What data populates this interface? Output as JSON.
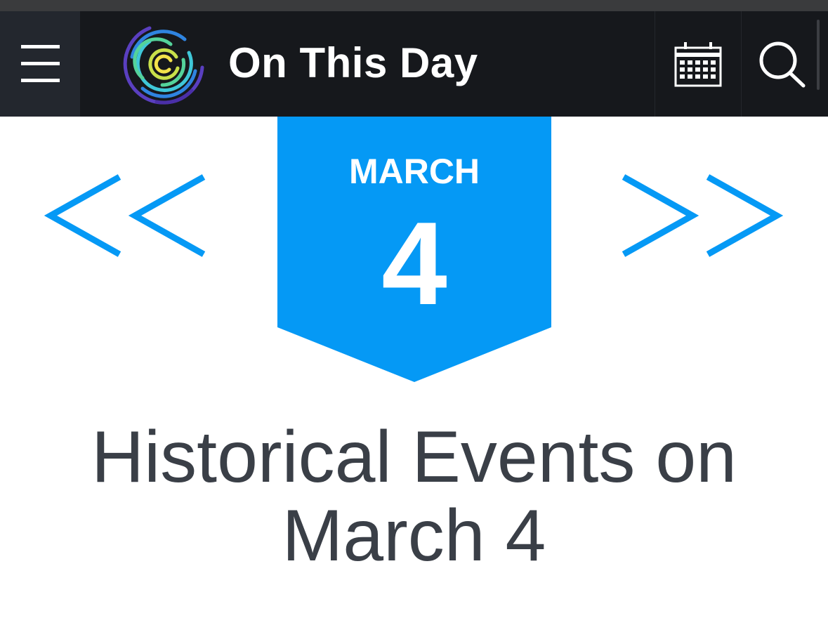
{
  "header": {
    "site_title": "On This Day",
    "menu_icon": "hamburger-menu-icon",
    "logo_icon": "spiral-rings-logo",
    "calendar_icon": "calendar-icon",
    "search_icon": "search-icon",
    "colors": {
      "header_bg": "#16181c",
      "menu_bg": "#23272e",
      "logo_rings": [
        "#5a3fc0",
        "#2f84e0",
        "#3fc7d8",
        "#54d39b",
        "#c9e04a",
        "#f3e24a"
      ]
    }
  },
  "date_badge": {
    "month": "MARCH",
    "day": "4",
    "color": "#0599f5"
  },
  "navigation": {
    "prev_label": "<<",
    "next_label": ">>",
    "color": "#0599f5"
  },
  "main": {
    "heading_line1": "Historical Events on",
    "heading_line2": "March 4",
    "heading_color": "#3a3f47"
  }
}
